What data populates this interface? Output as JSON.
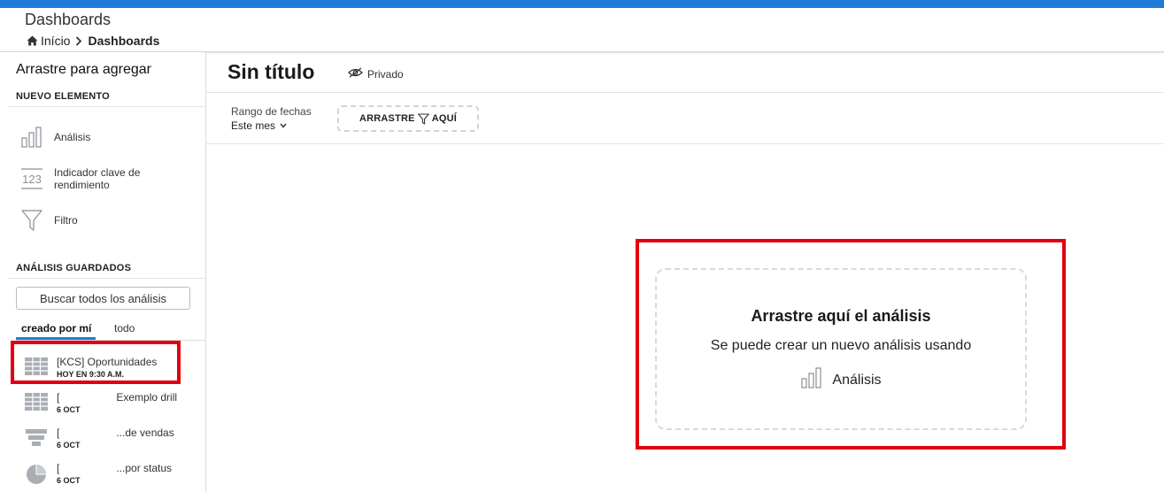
{
  "header": {
    "title": "Dashboards",
    "breadcrumb": {
      "home": "Início",
      "current": "Dashboards"
    }
  },
  "sidebar": {
    "title": "Arrastre para agregar",
    "new_section": "NUEVO ELEMENTO",
    "new_items": [
      {
        "label": "Análisis",
        "icon": "bar-chart-icon"
      },
      {
        "label": "Indicador clave de rendimiento",
        "icon": "kpi-123-icon"
      },
      {
        "label": "Filtro",
        "icon": "funnel-icon"
      }
    ],
    "saved_section": "ANÁLISIS GUARDADOS",
    "search_placeholder": "Buscar todos los análisis",
    "tabs": [
      {
        "label": "creado por mí"
      },
      {
        "label": "todo"
      }
    ],
    "saved_items": [
      {
        "name": "[KCS] Oportunidades",
        "date": "HOY EN 9:30 A.M.",
        "icon": "table-icon"
      },
      {
        "name_prefix": "[",
        "name_suffix": "Exemplo drill",
        "date": "6 OCT",
        "icon": "table-icon"
      },
      {
        "name_prefix": "[",
        "name_suffix": "...de vendas",
        "date": "6 OCT",
        "icon": "funnel-chart-icon"
      },
      {
        "name_prefix": "[",
        "name_suffix": "...por status",
        "date": "6 OCT",
        "icon": "pie-chart-icon"
      }
    ]
  },
  "main": {
    "title": "Sin título",
    "privacy": "Privado",
    "date_range": {
      "label": "Rango de fechas",
      "value": "Este mes"
    },
    "filter_drop": {
      "left": "ARRASTRE",
      "right": "AQUÍ"
    },
    "drop_zone": {
      "title": "Arrastre aquí el análisis",
      "subtitle": "Se puede crear un nuevo análisis usando",
      "item_label": "Análisis"
    }
  },
  "colors": {
    "topbar": "#1f7bd9",
    "tab_accent": "#1f7bd9",
    "highlight": "#e0000f"
  }
}
